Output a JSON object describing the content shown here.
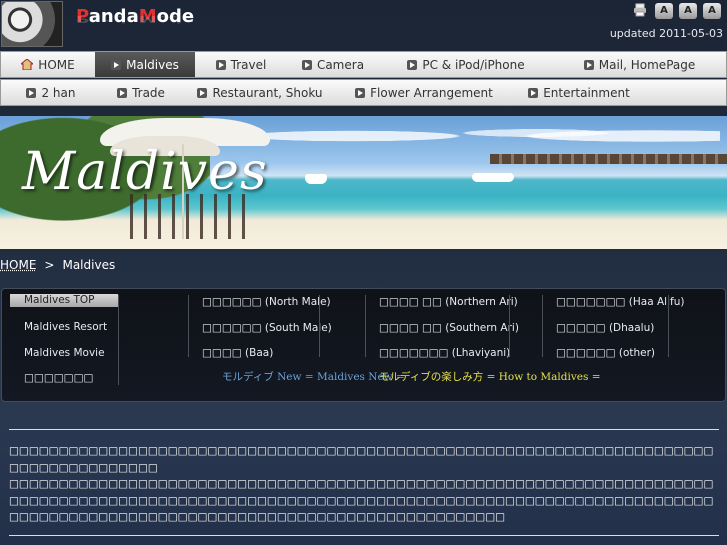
{
  "header": {
    "logo_part1": "P",
    "logo_part2": "anda",
    "logo_part3": "M",
    "logo_part4": "ode",
    "logo_full": "PandaMode",
    "updated": "updated 2011-05-03",
    "tools": {
      "print": "print-icon",
      "font_small": "A",
      "font_medium": "A",
      "font_large": "A"
    }
  },
  "nav": {
    "row1": [
      {
        "label": "HOME",
        "icon": "home-icon"
      },
      {
        "label": "Maldives",
        "icon": "play-icon",
        "active": true
      },
      {
        "label": "Travel",
        "icon": "play-icon"
      },
      {
        "label": "Camera",
        "icon": "play-icon"
      },
      {
        "label": "PC & iPod/iPhone",
        "icon": "play-icon"
      },
      {
        "label": "Mail, HomePage",
        "icon": "play-icon"
      }
    ],
    "row2": [
      {
        "label": "2 han",
        "icon": "play-icon"
      },
      {
        "label": "Trade",
        "icon": "play-icon"
      },
      {
        "label": "Restaurant, Shoku",
        "icon": "play-icon"
      },
      {
        "label": "Flower Arrangement",
        "icon": "play-icon"
      },
      {
        "label": "Entertainment",
        "icon": "play-icon"
      }
    ]
  },
  "banner": {
    "title": "Maldives"
  },
  "breadcrumb": {
    "home": "HOME",
    "sep": ">",
    "current": "Maldives"
  },
  "menu": {
    "col1": [
      "Maldives TOP",
      "Maldives Resort",
      "Maldives Movie",
      "□□□□□□□"
    ],
    "col2": [
      "□□□□□□ (North Male)",
      "□□□□□□ (South Male)",
      "□□□□ (Baa)"
    ],
    "col3": [
      "□□□□ □□ (Northern Ari)",
      "□□□□ □□ (Southern Ari)",
      "□□□□□□□ (Lhaviyani)"
    ],
    "col4": [
      "□□□□□□□ (Haa Alifu)",
      "□□□□□ (Dhaalu)",
      "□□□□□□ (other)"
    ],
    "link_new": "モルディブ New = Maldives New =",
    "link_howto": "モルディブの楽しみ方 = How to Maldives ="
  },
  "content": {
    "para1": "□□□□□□□□□□□□□□□□□□□□□□□□□□□□□□□□□□□□□□□□□□□□□□□□□□□□□□□□□□□□□□□□□□□□□□□□□□□□□□□□□□□□□□",
    "para2": "□□□□□□□□□□□□□□□□□□□□□□□□□□□□□□□□□□□□□□□□□□□□□□□□□□□□□□□□□□□□□□□□□□□□□□□□□□□□□□□□□□□□□□□□□□□□□□□□□□□□□□□□□□□□□□□□□□□□□□□□□□□□□□□□□□□□□□□□□□□□□□□□□□□□□□□□□□□□□□□□□□□□□□□□□□□□□□□□□□□□□□□□□□□□□□□□"
  },
  "colors": {
    "accent_red": "#e03030",
    "link_blue": "#6aa2d8",
    "link_yellow": "#e6e04a"
  }
}
